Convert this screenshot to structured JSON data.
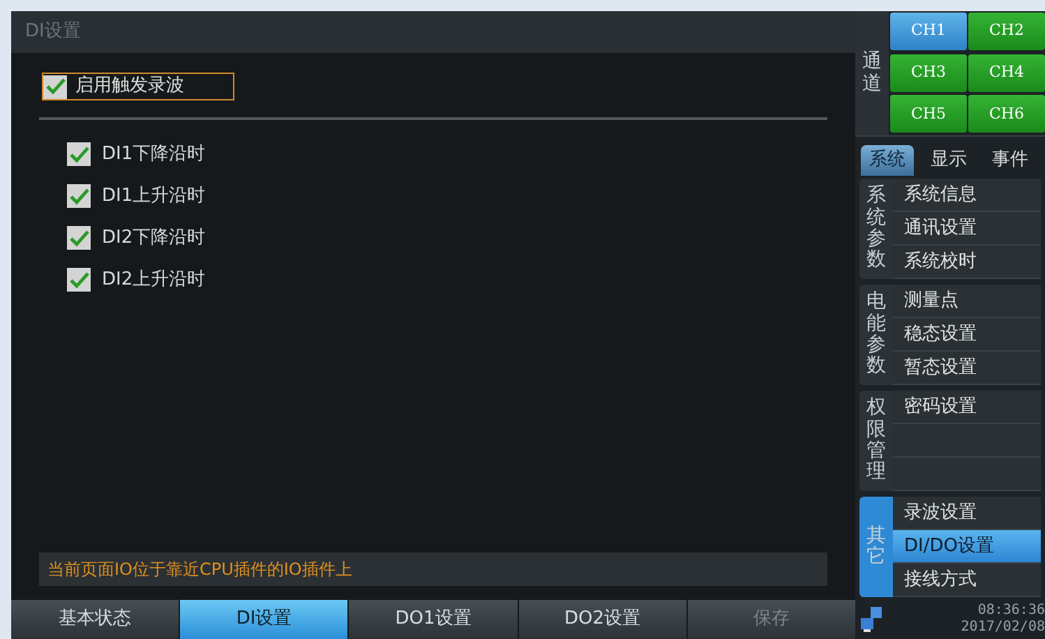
{
  "panel": {
    "title": "DI设置",
    "trigger": {
      "label": "启用触发录波",
      "checked": true,
      "focused": true
    },
    "options": [
      {
        "label": "DI1下降沿时",
        "checked": true
      },
      {
        "label": "DI1上升沿时",
        "checked": true
      },
      {
        "label": "DI2下降沿时",
        "checked": true
      },
      {
        "label": "DI2上升沿时",
        "checked": true
      }
    ],
    "info": "当前页面IO位于靠近CPU插件的IO插件上"
  },
  "bottom_tabs": [
    {
      "label": "基本状态",
      "selected": false,
      "disabled": false
    },
    {
      "label": "DI设置",
      "selected": true,
      "disabled": false
    },
    {
      "label": "DO1设置",
      "selected": false,
      "disabled": false
    },
    {
      "label": "DO2设置",
      "selected": false,
      "disabled": false
    },
    {
      "label": "保存",
      "selected": false,
      "disabled": true
    }
  ],
  "channels": {
    "label": "通道",
    "items": [
      {
        "label": "CH1",
        "selected": true
      },
      {
        "label": "CH2",
        "selected": false
      },
      {
        "label": "CH3",
        "selected": false
      },
      {
        "label": "CH4",
        "selected": false
      },
      {
        "label": "CH5",
        "selected": false
      },
      {
        "label": "CH6",
        "selected": false
      }
    ]
  },
  "menu_tabs": [
    {
      "label": "系统",
      "selected": true
    },
    {
      "label": "显示",
      "selected": false
    },
    {
      "label": "事件",
      "selected": false
    }
  ],
  "menu_groups": [
    {
      "label": "系统参数",
      "selected": false,
      "items": [
        {
          "label": "系统信息",
          "selected": false
        },
        {
          "label": "通讯设置",
          "selected": false
        },
        {
          "label": "系统校时",
          "selected": false
        }
      ]
    },
    {
      "label": "电能参数",
      "selected": false,
      "items": [
        {
          "label": "测量点",
          "selected": false
        },
        {
          "label": "稳态设置",
          "selected": false
        },
        {
          "label": "暂态设置",
          "selected": false
        }
      ]
    },
    {
      "label": "权限管理",
      "selected": false,
      "items": [
        {
          "label": "密码设置",
          "selected": false
        }
      ]
    },
    {
      "label": "其它",
      "selected": true,
      "items": [
        {
          "label": "录波设置",
          "selected": false
        },
        {
          "label": "DI/DO设置",
          "selected": true
        },
        {
          "label": "接线方式",
          "selected": false
        }
      ]
    }
  ],
  "status": {
    "time": "08:36:36",
    "date": "2017/02/08"
  }
}
